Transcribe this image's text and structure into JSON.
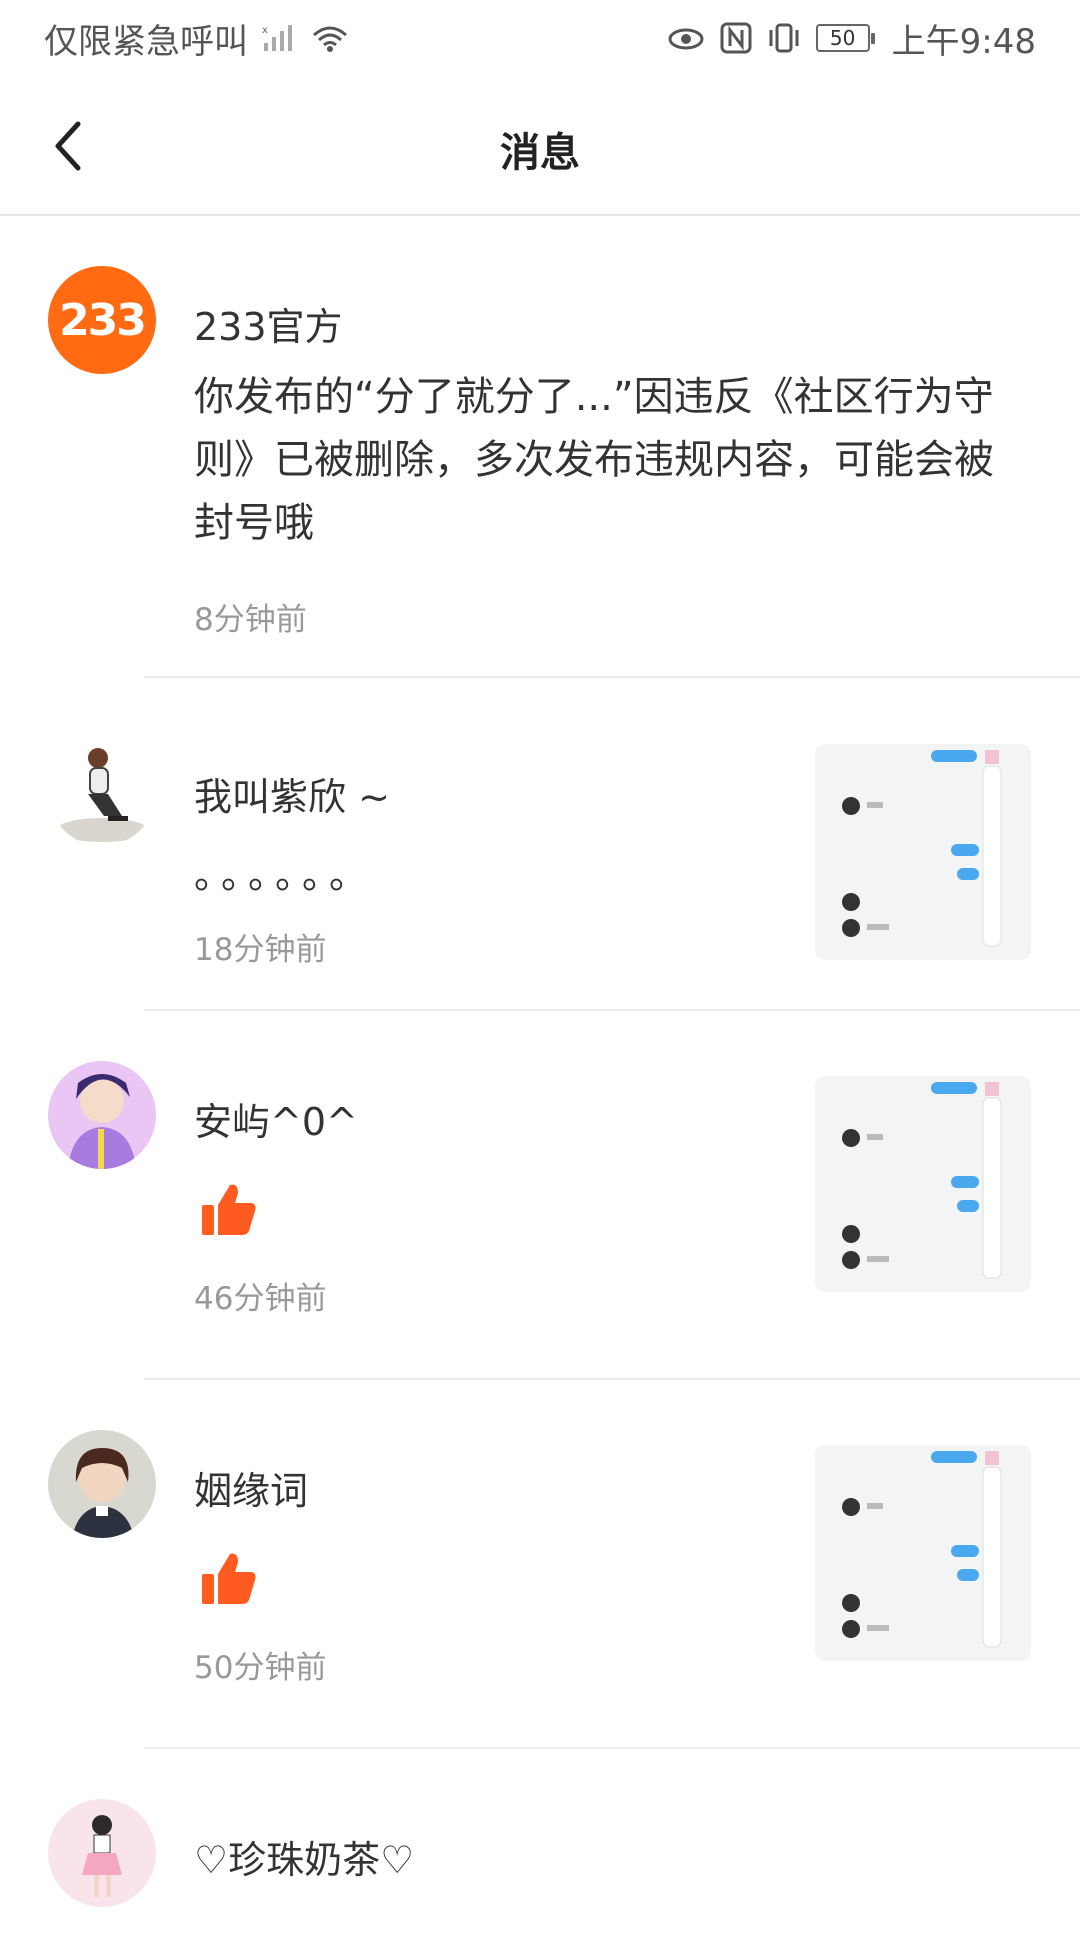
{
  "status": {
    "carrier": "仅限紧急呼叫",
    "battery": "50",
    "time": "上午9:48"
  },
  "header": {
    "title": "消息",
    "back_icon": "chevron-left-icon"
  },
  "colors": {
    "brand": "#FF6A13",
    "time_text": "#999999",
    "divider": "#ECECEC"
  },
  "messages": [
    {
      "avatar_text": "233",
      "name": "233官方",
      "content": "你发布的“分了就分了...”因违反《社区行为守则》已被删除，多次发布违规内容，可能会被封号哦",
      "time": "8分钟前"
    },
    {
      "name": "我叫紫欣 ~",
      "content": "。。。。。。",
      "time": "18分钟前"
    },
    {
      "name": "安屿^0^",
      "content_icon": "thumbs-up-icon",
      "time": "46分钟前"
    },
    {
      "name": "姻缘词",
      "content_icon": "thumbs-up-icon",
      "time": "50分钟前"
    },
    {
      "name": "♡珍珠奶茶♡"
    }
  ]
}
